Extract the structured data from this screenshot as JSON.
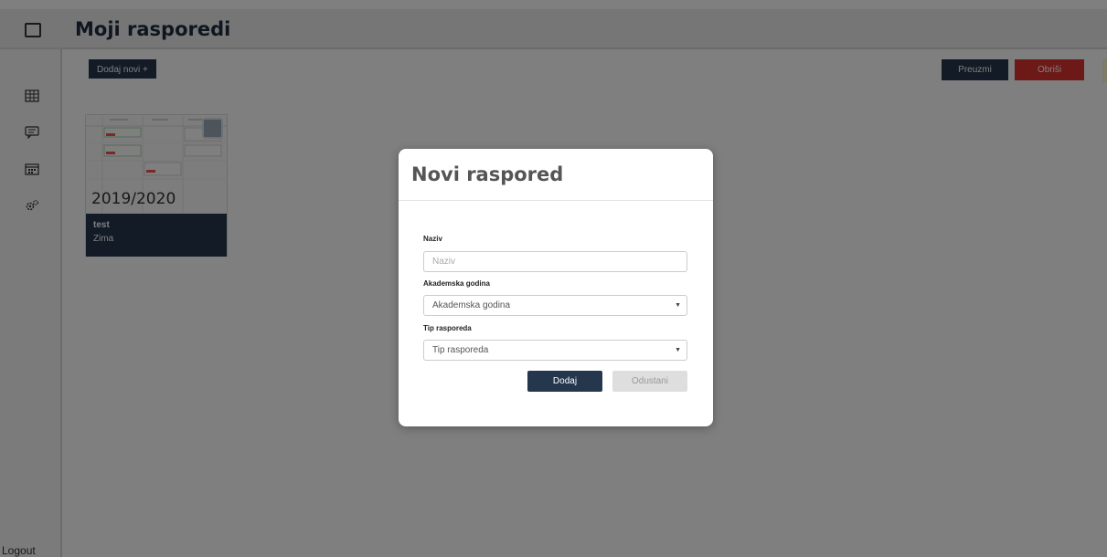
{
  "header": {
    "title": "Moji rasporedi"
  },
  "toolbar": {
    "add_label": "Dodaj novi +",
    "download_label": "Preuzmi",
    "delete_label": "Obriši"
  },
  "sidebar": {
    "icons": [
      "grid-icon",
      "chat-icon",
      "calendar-icon",
      "settings-icon"
    ],
    "logout_label": "Logout"
  },
  "schedule_card": {
    "year": "2019/2020",
    "name": "test",
    "term": "Zima"
  },
  "modal": {
    "title": "Novi raspored",
    "name_label": "Naziv",
    "name_placeholder": "Naziv",
    "year_label": "Akademska godina",
    "year_value": "Akademska godina",
    "type_label": "Tip rasporeda",
    "type_value": "Tip rasporeda",
    "submit_label": "Dodaj",
    "cancel_label": "Odustani"
  },
  "colors": {
    "primary": "#24374d",
    "danger": "#d9322f",
    "overlay": "#000000"
  }
}
